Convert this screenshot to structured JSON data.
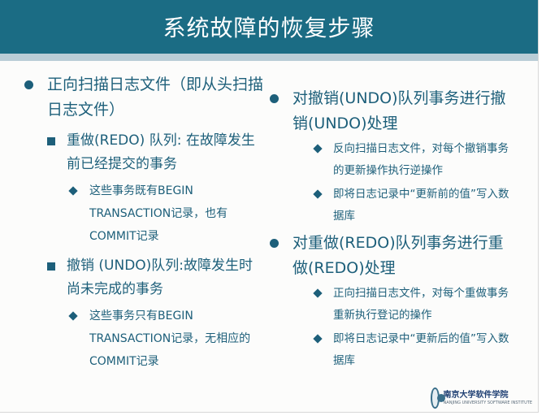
{
  "title": "系统故障的恢复步骤",
  "left": {
    "item1": "正向扫描日志文件（即从头扫描日志文件）",
    "redo": {
      "label": "重做(REDO) 队列: 在故障发生前已经提交的事务",
      "sub": "这些事务既有BEGIN TRANSACTION记录，也有COMMIT记录"
    },
    "undo": {
      "label": "撤销 (UNDO)队列:故障发生时尚未完成的事务",
      "sub": " 这些事务只有BEGIN TRANSACTION记录，无相应的COMMIT记录"
    }
  },
  "right": {
    "undo_step": {
      "label": "对撤销(UNDO)队列事务进行撤销(UNDO)处理",
      "subs": [
        "反向扫描日志文件，对每个撤销事务的更新操作执行逆操作",
        "即将日志记录中“更新前的值”写入数据库"
      ]
    },
    "redo_step": {
      "label": "对重做(REDO)队列事务进行重做(REDO)处理",
      "subs": [
        "正向扫描日志文件，对每个重做事务重新执行登记的操作",
        "即将日志记录中“更新后的值”写入数据库"
      ]
    }
  },
  "logo": {
    "main": "南京大学软件学院",
    "sub": "NANJING UNIVERSITY SOFTWARE INSTITUTE"
  }
}
